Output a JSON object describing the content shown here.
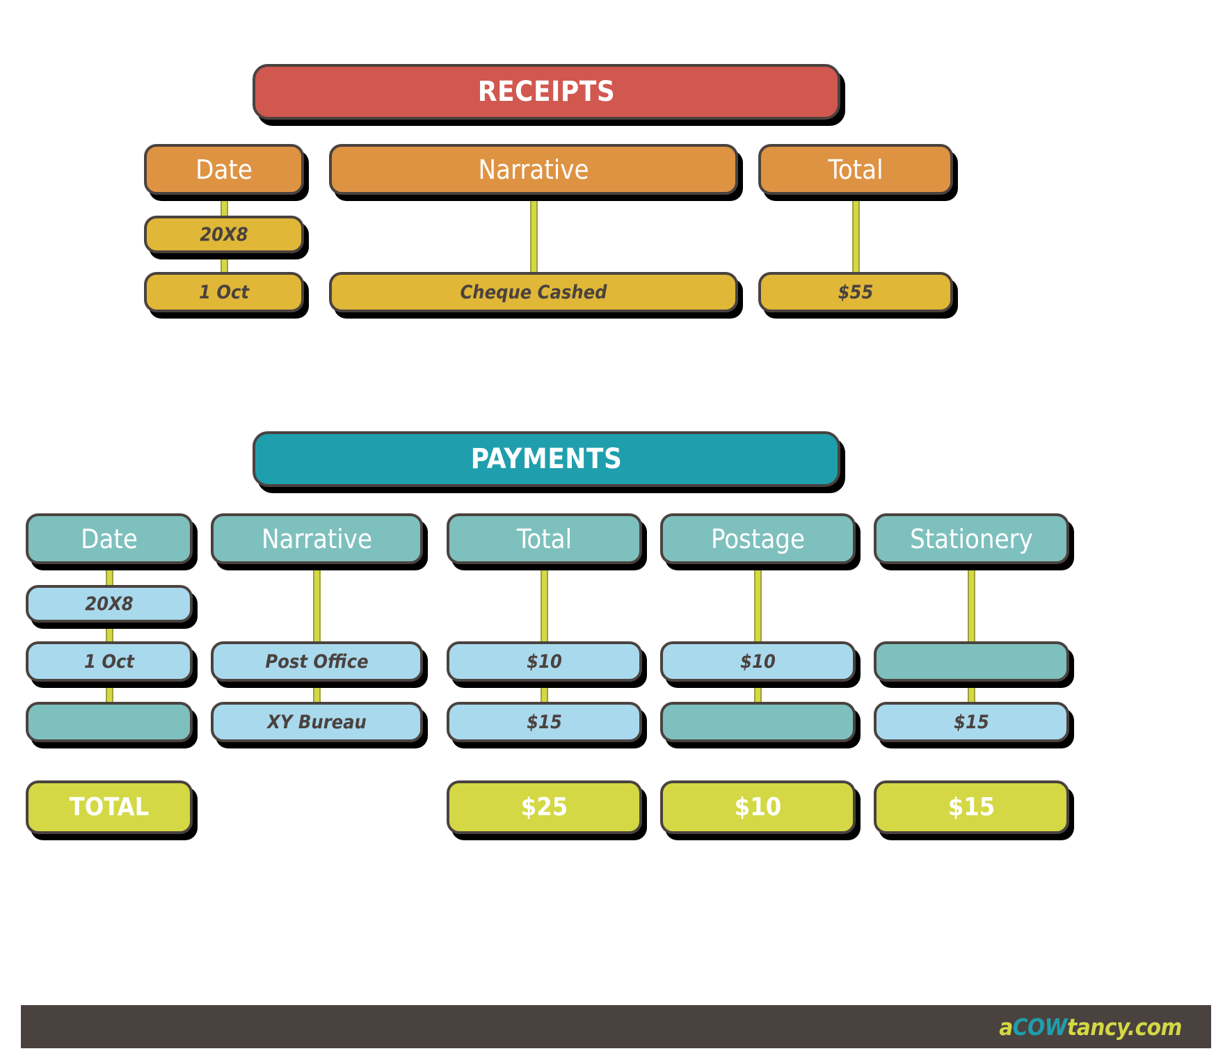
{
  "colors": {
    "receipts_banner": "#d0584f",
    "payments_banner": "#1f9fad",
    "receipts_header": "#de9343",
    "receipts_cell": "#e0b737",
    "payments_header": "#7ec0bd",
    "payments_cell": "#a9d9ec",
    "totals_cell": "#d3d844",
    "outline": "#4a423f",
    "connector": "#d3d844",
    "footer_bar": "#4a423f"
  },
  "receipts": {
    "banner": "RECEIPTS",
    "headers": [
      "Date",
      "Narrative",
      "Total"
    ],
    "rows": [
      {
        "date": "20X8",
        "narrative": "",
        "total": ""
      },
      {
        "date": "1 Oct",
        "narrative": "Cheque Cashed",
        "total": "$55"
      }
    ]
  },
  "payments": {
    "banner": "PAYMENTS",
    "headers": [
      "Date",
      "Narrative",
      "Total",
      "Postage",
      "Stationery"
    ],
    "rows": [
      {
        "date": "20X8",
        "narrative": "",
        "total": "",
        "postage": "",
        "stationery": ""
      },
      {
        "date": "1 Oct",
        "narrative": "Post Office",
        "total": "$10",
        "postage": "$10",
        "stationery": ""
      },
      {
        "date": "",
        "narrative": "XY Bureau",
        "total": "$15",
        "postage": "",
        "stationery": "$15"
      }
    ],
    "totals": {
      "label": "TOTAL",
      "date": "",
      "narrative": "",
      "total": "$25",
      "postage": "$10",
      "stationery": "$15"
    }
  },
  "footer": {
    "logo_part_1": "a",
    "logo_part_2": "COW",
    "logo_part_3": "tancy.com"
  }
}
